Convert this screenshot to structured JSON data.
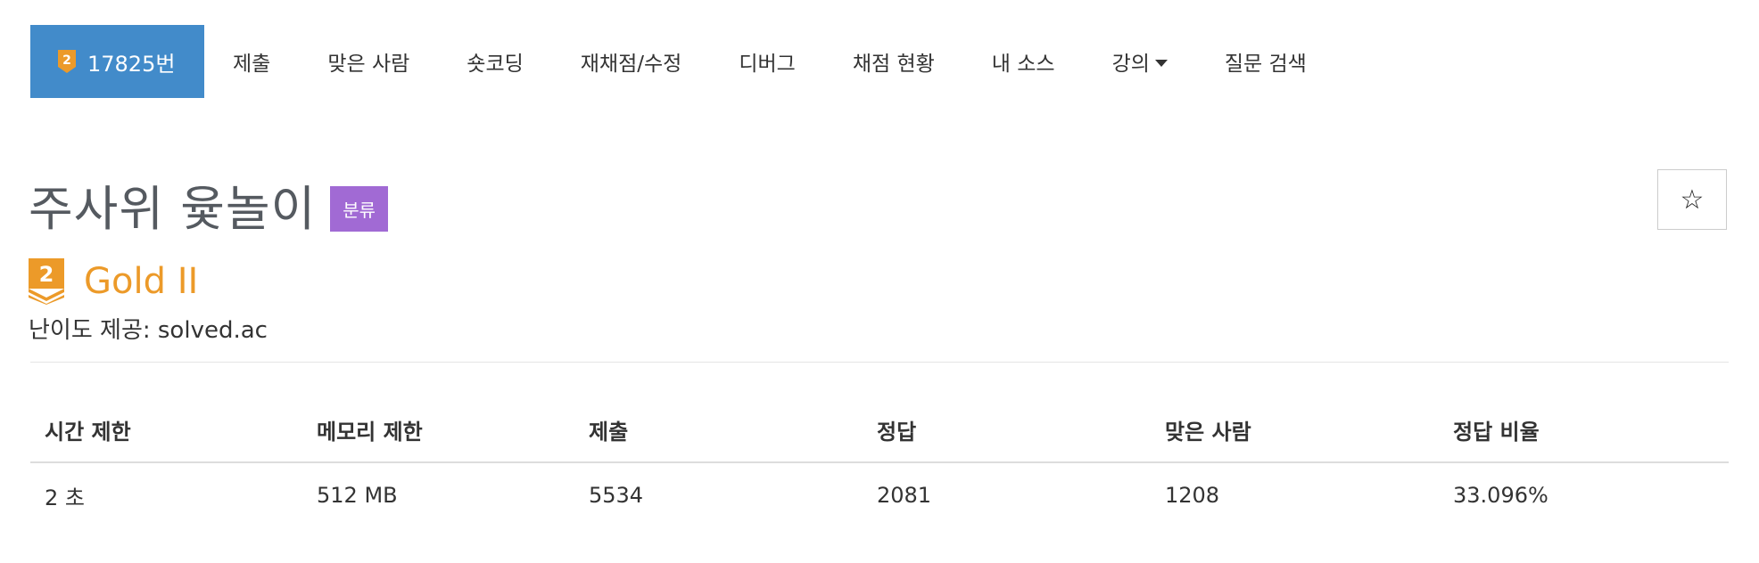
{
  "nav": {
    "active_label": "17825번",
    "active_icon": "gold-tier-icon",
    "items": [
      "제출",
      "맞은 사람",
      "숏코딩",
      "재채점/수정",
      "디버그",
      "채점 현황",
      "내 소스",
      "강의",
      "질문 검색"
    ]
  },
  "problem": {
    "title": "주사위 윷놀이",
    "tag_label": "분류",
    "star_label": "☆"
  },
  "tier": {
    "badge_digit": "2",
    "label": "Gold II",
    "color": "#ec9a29"
  },
  "provider_text": "난이도 제공: solved.ac",
  "stats": {
    "headers": [
      "시간 제한",
      "메모리 제한",
      "제출",
      "정답",
      "맞은 사람",
      "정답 비율"
    ],
    "values": [
      "2 초",
      "512 MB",
      "5534",
      "2081",
      "1208",
      "33.096%"
    ]
  },
  "colors": {
    "nav_active_bg": "#428bca",
    "tag_bg": "#a16ad4",
    "tier_gold": "#ec9a29"
  }
}
